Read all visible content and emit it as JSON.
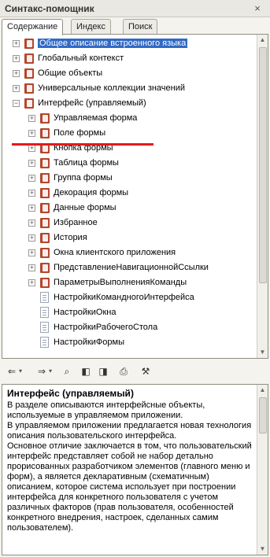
{
  "window": {
    "title": "Синтакс-помощник",
    "close_glyph": "×"
  },
  "tabs": [
    {
      "label": "Содержание",
      "active": true
    },
    {
      "label": "Индекс",
      "active": false
    },
    {
      "label": "Поиск",
      "active": false
    }
  ],
  "tree": {
    "items": [
      {
        "label": "Общее описание встроенного языка",
        "level": 0,
        "icon": "book-icon",
        "expander": "plus",
        "selected": true
      },
      {
        "label": "Глобальный контекст",
        "level": 0,
        "icon": "book-icon",
        "expander": "plus"
      },
      {
        "label": "Общие объекты",
        "level": 0,
        "icon": "book-icon",
        "expander": "plus"
      },
      {
        "label": "Универсальные коллекции значений",
        "level": 0,
        "icon": "book-icon",
        "expander": "plus"
      },
      {
        "label": "Интерфейс (управляемый)",
        "level": 0,
        "icon": "book-icon",
        "expander": "minus"
      },
      {
        "label": "Управляемая форма",
        "level": 1,
        "icon": "book-icon",
        "expander": "plus"
      },
      {
        "label": "Поле формы",
        "level": 1,
        "icon": "book-icon",
        "expander": "plus"
      },
      {
        "label": "Кнопка формы",
        "level": 1,
        "icon": "book-icon",
        "expander": "plus"
      },
      {
        "label": "Таблица формы",
        "level": 1,
        "icon": "book-icon",
        "expander": "plus"
      },
      {
        "label": "Группа формы",
        "level": 1,
        "icon": "book-icon",
        "expander": "plus"
      },
      {
        "label": "Декорация формы",
        "level": 1,
        "icon": "book-icon",
        "expander": "plus"
      },
      {
        "label": "Данные формы",
        "level": 1,
        "icon": "book-icon",
        "expander": "plus"
      },
      {
        "label": "Избранное",
        "level": 1,
        "icon": "book-icon",
        "expander": "plus"
      },
      {
        "label": "История",
        "level": 1,
        "icon": "book-icon",
        "expander": "plus"
      },
      {
        "label": "Окна клиентского приложения",
        "level": 1,
        "icon": "book-icon",
        "expander": "plus"
      },
      {
        "label": "ПредставлениеНавигационнойСсылки",
        "level": 1,
        "icon": "book-icon",
        "expander": "plus"
      },
      {
        "label": "ПараметрыВыполненияКоманды",
        "level": 1,
        "icon": "book-icon",
        "expander": "plus"
      },
      {
        "label": "НастройкиКомандногоИнтерфейса",
        "level": 1,
        "icon": "page-icon",
        "expander": "none"
      },
      {
        "label": "НастройкиОкна",
        "level": 1,
        "icon": "page-icon",
        "expander": "none"
      },
      {
        "label": "НастройкиРабочегоСтола",
        "level": 1,
        "icon": "page-icon",
        "expander": "none"
      },
      {
        "label": "НастройкиФормы",
        "level": 1,
        "icon": "page-icon",
        "expander": "none"
      }
    ]
  },
  "toolbar": {
    "buttons": [
      {
        "name": "back-icon",
        "glyph": "⇐"
      },
      {
        "name": "dropdown-arrow-icon",
        "glyph": "▾"
      },
      {
        "name": "forward-icon",
        "glyph": "⇒"
      },
      {
        "name": "dropdown-arrow-icon",
        "glyph": "▾"
      },
      {
        "name": "find-in-tree-icon",
        "glyph": "⌕"
      },
      {
        "name": "previous-topic-icon",
        "glyph": "◧"
      },
      {
        "name": "next-topic-icon",
        "glyph": "◨"
      },
      {
        "name": "print-icon",
        "glyph": "⎙"
      },
      {
        "name": "settings-icon",
        "glyph": "⚒"
      }
    ]
  },
  "description": {
    "title": "Интерфейс (управляемый)",
    "paragraphs": [
      "В разделе описываются интерфейсные объекты, используемые в управляемом приложении.",
      "В управляемом приложении предлагается новая технология описания пользовательского интерфейса.",
      "Основное отличие заключается в том, что пользовательский интерфейс представляет собой не набор детально прорисованных разработчиком элементов (главного меню и форм), а является декларативным (схематичным) описанием, которое система использует при построении интерфейса для конкретного пользователя с учетом различных факторов (прав пользователя, особенностей конкретного внедрения, настроек, сделанных самим пользователем)."
    ]
  },
  "colors": {
    "selection": "#316ac5",
    "book": "#b5462c",
    "highlight": "#e61919"
  }
}
